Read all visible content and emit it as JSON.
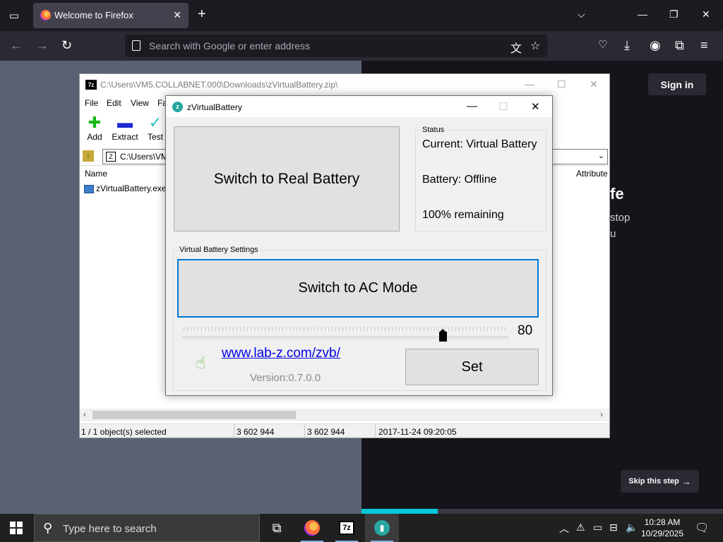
{
  "firefox": {
    "tab_title": "Welcome to Firefox",
    "url_placeholder": "Search with Google or enter address",
    "sign_in": "Sign in",
    "headline_fragment": "fe",
    "body_line1": "stop",
    "body_line2": "u",
    "skip_label": "Skip this step",
    "onboarding_progress_fraction": 0.21
  },
  "sevenzip": {
    "title_path": "C:\\Users\\VM5.COLLABNET.000\\Downloads\\zVirtualBattery.zip\\",
    "menu": [
      "File",
      "Edit",
      "View",
      "Fa"
    ],
    "toolbar": {
      "add": "Add",
      "extract": "Extract",
      "test": "Test"
    },
    "address": "C:\\Users\\VM",
    "col_name": "Name",
    "col_attributes": "Attribute",
    "file_name": "zVirtualBattery.exe",
    "status": {
      "selected": "1 / 1 object(s) selected",
      "size": "3 602 944",
      "packed": "3 602 944",
      "modified": "2017-11-24 09:20:05"
    }
  },
  "zvb": {
    "title": "zVirtualBattery",
    "switch_real": "Switch to Real Battery",
    "status_legend": "Status",
    "current": "Current: Virtual Battery",
    "battery": "Battery: Offline",
    "remaining": "100% remaining",
    "settings_legend": "Virtual Battery Settings",
    "switch_ac": "Switch to AC Mode",
    "slider_value": "80",
    "link": "www.lab-z.com/zvb/",
    "version": "Version:0.7.0.0",
    "set": "Set"
  },
  "taskbar": {
    "search_placeholder": "Type here to search",
    "time": "10:28 AM",
    "date": "10/29/2025"
  },
  "colors": {
    "accent_blue": "#0078d7",
    "firefox_dark": "#1c1b22",
    "progress_cyan": "#00c8d7"
  }
}
